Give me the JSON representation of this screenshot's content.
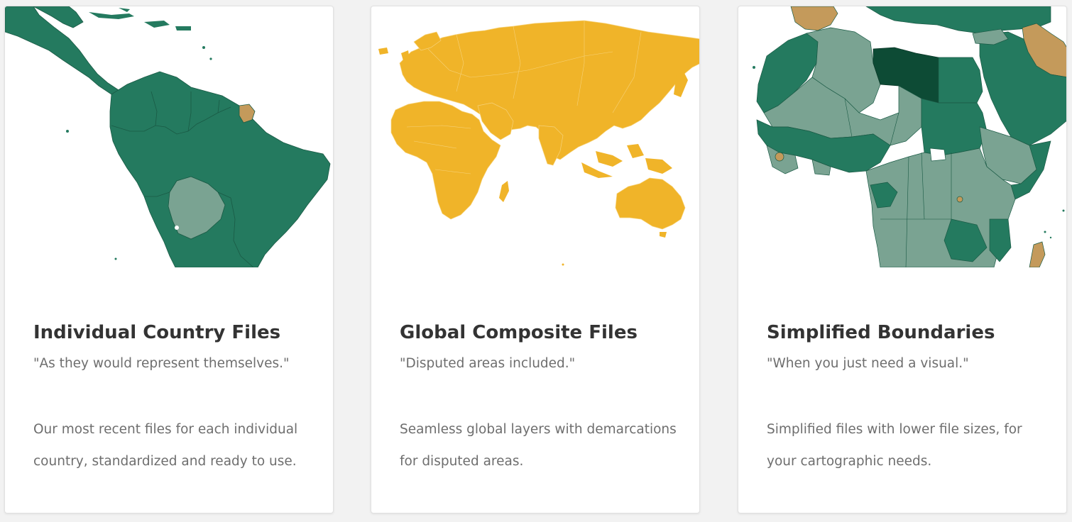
{
  "colors": {
    "green": "#247a5f",
    "light_green": "#7aa392",
    "dark_green": "#0d4b35",
    "orange": "#c49a5b",
    "gold": "#f0b429",
    "text_dark": "#333333",
    "text_muted": "#6e6e6e"
  },
  "cards": [
    {
      "map_icon": "americas-map",
      "title": "Individual Country Files",
      "quote": "\"As they would represent themselves.\"",
      "description": "Our most recent files for each individual country, standardized and ready to use."
    },
    {
      "map_icon": "eurasia-africa-map",
      "title": "Global Composite Files",
      "quote": "\"Disputed areas included.\"",
      "description": "Seamless global layers with demarcations for disputed areas."
    },
    {
      "map_icon": "africa-middle-east-map",
      "title": "Simplified Boundaries",
      "quote": "\"When you just need a visual.\"",
      "description": "Simplified files with lower file sizes, for your cartographic needs."
    }
  ]
}
